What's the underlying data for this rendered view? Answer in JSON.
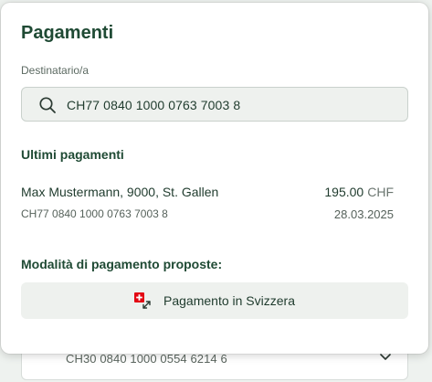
{
  "background_field": {
    "value": "CH30 0840 1000 0554 6214 6",
    "icon": "chevron-down-icon"
  },
  "popover": {
    "title": "Pagamenti",
    "recipient_label": "Destinatario/a",
    "search": {
      "value": "CH77 0840 1000 0763 7003 8",
      "icon": "search-icon"
    },
    "recent_title": "Ultimi pagamenti",
    "recent_payments": [
      {
        "name": "Max Mustermann, 9000, St. Gallen",
        "iban": "CH77 0840 1000 0763 7003 8",
        "amount": "195.00",
        "currency": "CHF",
        "date": "28.03.2025"
      }
    ],
    "modes_title": "Modalità di pagamento proposte:",
    "modes": [
      {
        "label": "Pagamento in Svizzera",
        "icon": "swiss-flag-transfer-icon"
      }
    ]
  },
  "colors": {
    "primary_text": "#1f4a34",
    "swiss_red": "#e30613",
    "button_bg": "#eef1ee"
  }
}
